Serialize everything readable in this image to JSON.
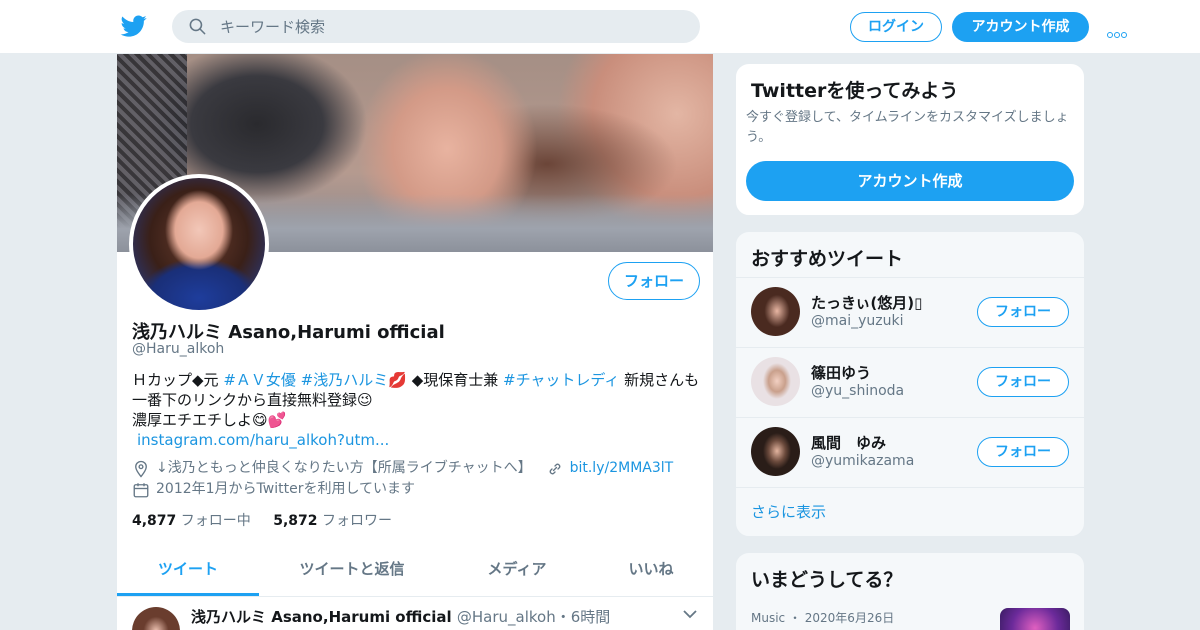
{
  "header": {
    "logo_icon": "twitter-bird-icon",
    "search_placeholder": "キーワード検索",
    "login_label": "ログイン",
    "signup_label": "アカウント作成",
    "brand_color": "#1da1f2"
  },
  "profile": {
    "follow_label": "フォロー",
    "name": "浅乃ハルミ Asano,Harumi official",
    "handle": "@Haru_alkoh",
    "bio": {
      "t1": "Ｈカップ◆元 ",
      "tag1": "#ＡＶ女優",
      "t2": " ",
      "tag2": "#浅乃ハルミ",
      "t3": "💋 ◆現保育士兼 ",
      "tag3": "#チャットレディ",
      "t4": " 新規さんも一番下のリンクから直接無料登録😉",
      "t5": "濃厚エチエチしよ😋💕",
      "link": "instagram.com/haru_alkoh?utm..."
    },
    "location": "↓浅乃ともっと仲良くなりたい方【所属ライブチャットへ】",
    "url": "bit.ly/2MMA3lT",
    "joined": "2012年1月からTwitterを利用しています",
    "following_count": "4,877",
    "following_label": "フォロー中",
    "followers_count": "5,872",
    "followers_label": "フォロワー"
  },
  "tabs": [
    "ツイート",
    "ツイートと返信",
    "メディア",
    "いいね"
  ],
  "tweet": {
    "name": "浅乃ハルミ Asano,Harumi official",
    "handle": "@Haru_alkoh",
    "time": "・6時間"
  },
  "signup_card": {
    "title": "Twitterを使ってみよう",
    "desc": "今すぐ登録して、タイムラインをカスタマイズしましょう。",
    "button": "アカウント作成"
  },
  "recommend": {
    "title": "おすすめツイート",
    "items": [
      {
        "name": "たっきぃ(悠月)▯",
        "handle": "@mai_yuzuki",
        "button": "フォロー"
      },
      {
        "name": "篠田ゆう",
        "handle": "@yu_shinoda",
        "button": "フォロー"
      },
      {
        "name": "風間　ゆみ",
        "handle": "@yumikazama",
        "button": "フォロー"
      }
    ],
    "show_more": "さらに表示"
  },
  "trends": {
    "title": "いまどうしてる？",
    "meta": "Music ・ 2020年6月26日"
  }
}
